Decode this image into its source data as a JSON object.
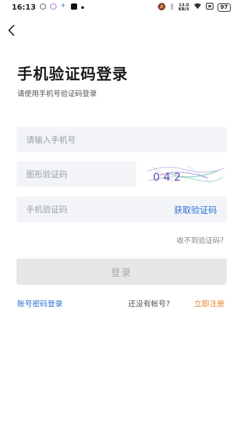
{
  "status_bar": {
    "time": "16:13",
    "net_speed_value": "13.0",
    "net_speed_unit": "KB/S",
    "battery": "97",
    "icons": [
      "circle-icon",
      "ring-icon",
      "bird-icon",
      "tiktok-icon",
      "dot-icon",
      "mute-icon",
      "bluetooth-icon",
      "wifi-icon",
      "screen-icon"
    ]
  },
  "header": {
    "title": "手机验证码登录",
    "subtitle": "请使用手机号验证码登录"
  },
  "form": {
    "phone_placeholder": "请输入手机号",
    "captcha_placeholder": "图形验证码",
    "captcha_text": "0 4 2",
    "sms_placeholder": "手机验证码",
    "get_code_label": "获取验证码",
    "no_code_label": "收不到验证码?",
    "login_label": "登录"
  },
  "footer": {
    "password_login": "账号密码登录",
    "no_account": "还没有帐号?",
    "register": "立即注册"
  },
  "colors": {
    "accent_blue": "#2d6fd6",
    "accent_orange": "#e6852e",
    "input_bg": "#f2f4f7",
    "button_disabled_bg": "#e6e6e6"
  }
}
